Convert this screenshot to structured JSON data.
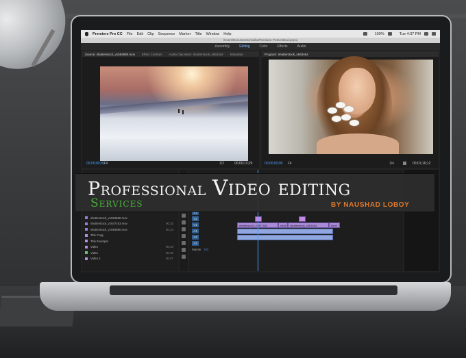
{
  "menubar": {
    "app": "Premiere Pro CC",
    "items": [
      "File",
      "Edit",
      "Clip",
      "Sequence",
      "Marker",
      "Title",
      "Window",
      "Help"
    ],
    "battery": "100%",
    "clock": "Tue 4:37 PM"
  },
  "pathbar": "/Users/Documents/Adobe/Premiere Pro/Untitled.prproj",
  "workspaces": [
    "Assembly",
    "Editing",
    "Color",
    "Effects",
    "Audio"
  ],
  "active_workspace": "Editing",
  "source": {
    "tabs": [
      "Source: shutterstock_v1594680.mov",
      "Effect Controls",
      "Audio Clip Mixer: shutterstock_v563464",
      "Metadata"
    ],
    "timecode": "00;00;00;00",
    "fit": "Fit",
    "fraction": "1/2",
    "duration": "00;00;13;29"
  },
  "program": {
    "tabs": [
      "Program: shutterstock_v563464"
    ],
    "timecode": "00;00;00;00",
    "fit": "Fit",
    "fraction": "1/4",
    "duration": "00;01;16;12"
  },
  "project": {
    "rows": [
      {
        "name": "shutterstock_v1594680.mov",
        "dur": "",
        "color": "#9b7fd6"
      },
      {
        "name": "shutterstock_v1647163.mov",
        "dur": "00;15",
        "color": "#9b7fd6"
      },
      {
        "name": "shutterstock_v1594680.mov",
        "dur": "00;13",
        "color": "#9b7fd6"
      },
      {
        "name": "Title Copy",
        "dur": "",
        "color": "#b58ee0"
      },
      {
        "name": "Title Example",
        "dur": "",
        "color": "#b58ee0"
      },
      {
        "name": "Video",
        "dur": "00;19",
        "color": "#b58ee0"
      },
      {
        "name": "Video",
        "dur": "00;19",
        "color": "#6fc26f"
      },
      {
        "name": "Video 2",
        "dur": "00;47",
        "color": "#b58ee0"
      }
    ]
  },
  "timeline": {
    "video_tracks": [
      "V3",
      "V2",
      "V1"
    ],
    "audio_tracks": [
      "A1",
      "A2",
      "A3"
    ],
    "master_label": "Master",
    "master_value": "0.0",
    "clips": [
      "shutterstock_v1647163",
      "shutt",
      "shutterstock_v563464",
      "shutt"
    ]
  },
  "banner": {
    "professional": "Professional",
    "video_editing": "Video editing",
    "services": "Services",
    "byline": "BY NAUSHAD LOBOY"
  },
  "colors": {
    "services_green": "#4ab53a",
    "byline_orange": "#e07a2d",
    "timecode_blue": "#4da3ff",
    "clip_purple": "#a98ad8",
    "audio_blue": "#8fa6de"
  },
  "icons": [
    "apple-icon",
    "wifi-icon",
    "battery-icon",
    "search-icon",
    "list-icon",
    "wrench-icon",
    "play-icon"
  ]
}
